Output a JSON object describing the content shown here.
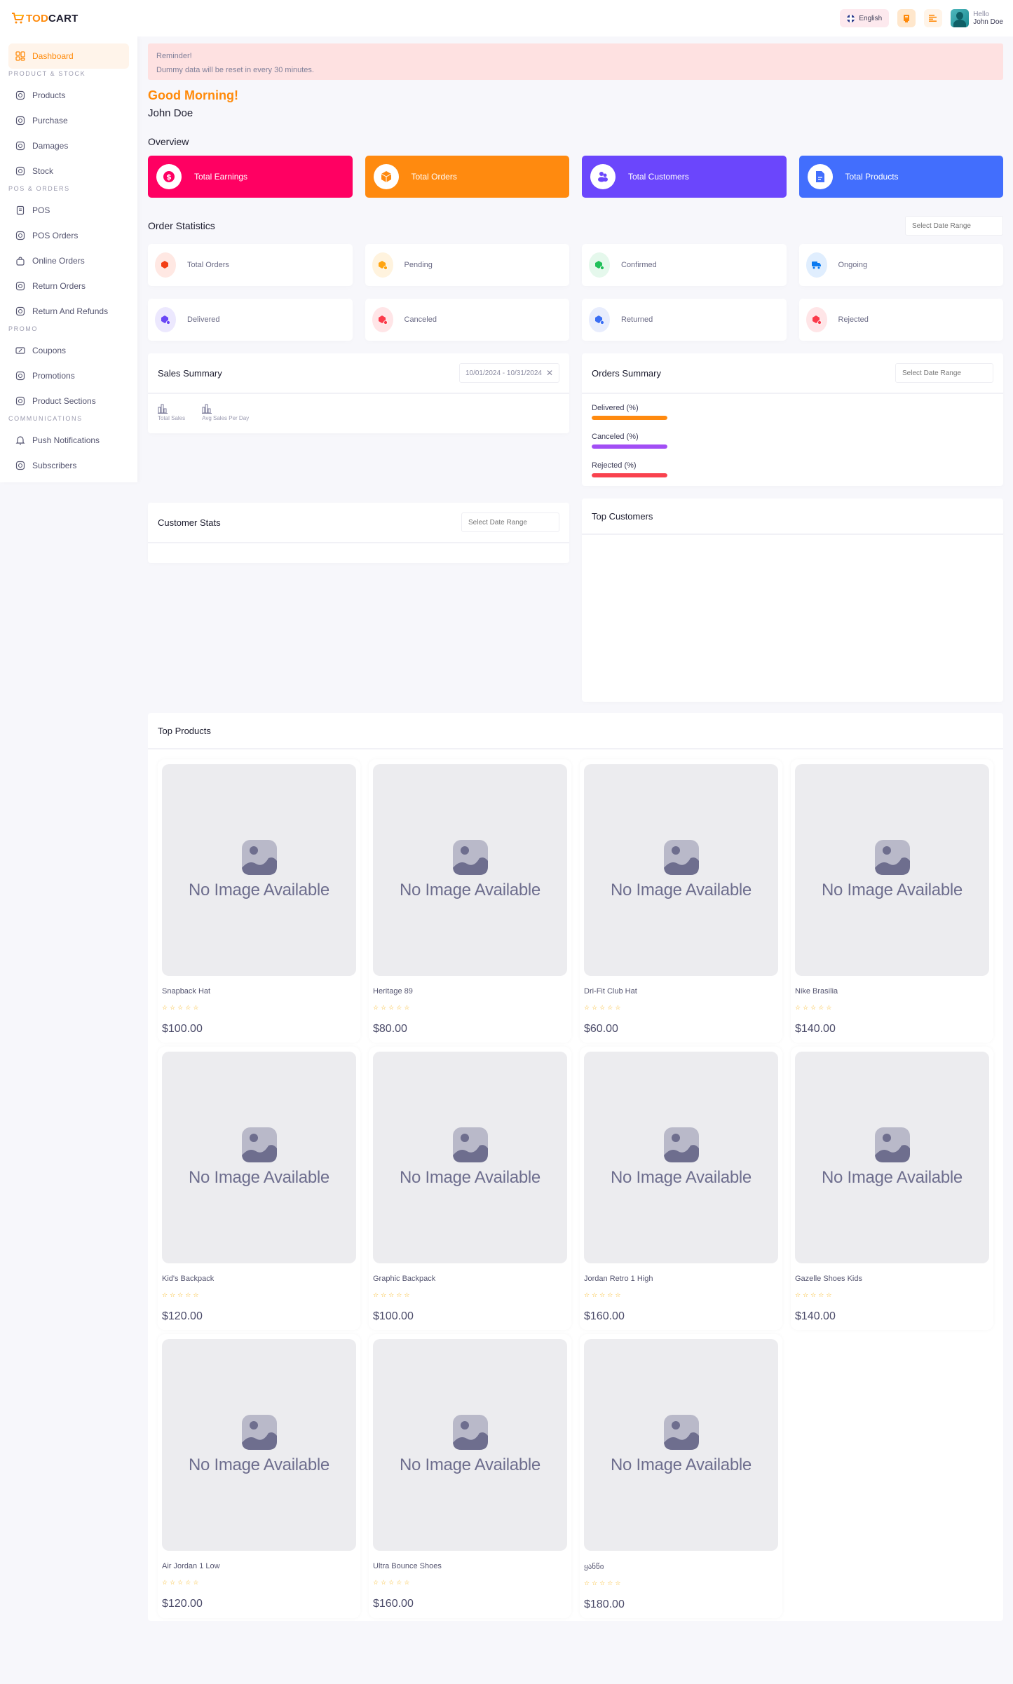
{
  "brand": {
    "part1": "TOD",
    "part2": "CART"
  },
  "header": {
    "language": "English",
    "user_greeting": "Hello",
    "user_name": "John Doe"
  },
  "sidebar": {
    "items": [
      {
        "type": "item",
        "label": "Dashboard",
        "icon": "dashboard-icon",
        "active": true
      },
      {
        "type": "section",
        "label": "PRODUCT & STOCK"
      },
      {
        "type": "item",
        "label": "Products",
        "icon": "products-icon"
      },
      {
        "type": "item",
        "label": "Purchase",
        "icon": "purchase-icon"
      },
      {
        "type": "item",
        "label": "Damages",
        "icon": "damages-icon"
      },
      {
        "type": "item",
        "label": "Stock",
        "icon": "stock-icon"
      },
      {
        "type": "section",
        "label": "POS & ORDERS"
      },
      {
        "type": "item",
        "label": "POS",
        "icon": "pos-icon"
      },
      {
        "type": "item",
        "label": "POS Orders",
        "icon": "pos-orders-icon"
      },
      {
        "type": "item",
        "label": "Online Orders",
        "icon": "online-orders-icon"
      },
      {
        "type": "item",
        "label": "Return Orders",
        "icon": "return-orders-icon"
      },
      {
        "type": "item",
        "label": "Return And Refunds",
        "icon": "refund-icon"
      },
      {
        "type": "section",
        "label": "PROMO"
      },
      {
        "type": "item",
        "label": "Coupons",
        "icon": "coupon-icon"
      },
      {
        "type": "item",
        "label": "Promotions",
        "icon": "promotion-icon"
      },
      {
        "type": "item",
        "label": "Product Sections",
        "icon": "product-sections-icon"
      },
      {
        "type": "section",
        "label": "COMMUNICATIONS"
      },
      {
        "type": "item",
        "label": "Push Notifications",
        "icon": "bell-icon"
      },
      {
        "type": "item",
        "label": "Subscribers",
        "icon": "subscribers-icon"
      }
    ]
  },
  "reminder": {
    "title": "Reminder!",
    "message": "Dummy data will be reset in every 30 minutes."
  },
  "greeting": "Good Morning!",
  "user_name": "John Doe",
  "overview": {
    "title": "Overview",
    "cards": [
      {
        "label": "Total Earnings",
        "color": "#ff0062",
        "icon": "dollar-icon"
      },
      {
        "label": "Total Orders",
        "color": "#ff8a0f",
        "icon": "box-icon"
      },
      {
        "label": "Total Customers",
        "color": "#6b46fc",
        "icon": "users-icon"
      },
      {
        "label": "Total Products",
        "color": "#426efd",
        "icon": "document-icon"
      }
    ]
  },
  "order_statistics": {
    "title": "Order Statistics",
    "date_placeholder": "Select Date Range",
    "cards": [
      {
        "label": "Total Orders",
        "color": "#f23e14",
        "bg": "#ffe8e3",
        "icon": "box-icon"
      },
      {
        "label": "Pending",
        "color": "#ffa411",
        "bg": "#fff3de",
        "icon": "box-pending-icon"
      },
      {
        "label": "Confirmed",
        "color": "#21c05a",
        "bg": "#e5f8ec",
        "icon": "box-confirmed-icon"
      },
      {
        "label": "Ongoing",
        "color": "#0b7af0",
        "bg": "#e0eefe",
        "icon": "truck-icon"
      },
      {
        "label": "Delivered",
        "color": "#6a47f6",
        "bg": "#ece8fe",
        "icon": "box-delivered-icon"
      },
      {
        "label": "Canceled",
        "color": "#fb3b4b",
        "bg": "#ffe5e7",
        "icon": "box-canceled-icon"
      },
      {
        "label": "Returned",
        "color": "#3a6ef4",
        "bg": "#e8edfd",
        "icon": "box-returned-icon"
      },
      {
        "label": "Rejected",
        "color": "#fb3b4b",
        "bg": "#ffe5e7",
        "icon": "box-rejected-icon"
      }
    ]
  },
  "sales_summary": {
    "title": "Sales Summary",
    "date_range": "10/01/2024 - 10/31/2024",
    "metrics": [
      "Total Sales",
      "Avg Sales Per Day"
    ]
  },
  "orders_summary": {
    "title": "Orders Summary",
    "date_placeholder": "Select Date Range",
    "bars": [
      {
        "label": "Delivered (%)",
        "color": "#ff8a0f",
        "percent": 100
      },
      {
        "label": "Canceled (%)",
        "color": "#a24ef5",
        "percent": 100
      },
      {
        "label": "Rejected (%)",
        "color": "#f9424e",
        "percent": 100
      }
    ]
  },
  "customer_stats": {
    "title": "Customer Stats",
    "date_placeholder": "Select Date Range"
  },
  "top_customers": {
    "title": "Top Customers"
  },
  "top_products": {
    "title": "Top Products",
    "no_image_text": "No Image Available",
    "items": [
      {
        "name": "Snapback Hat",
        "price": "$100.00",
        "rating": 0
      },
      {
        "name": "Heritage 89",
        "price": "$80.00",
        "rating": 0
      },
      {
        "name": "Dri-Fit Club Hat",
        "price": "$60.00",
        "rating": 0
      },
      {
        "name": "Nike Brasilia",
        "price": "$140.00",
        "rating": 0
      },
      {
        "name": "Kid's Backpack",
        "price": "$120.00",
        "rating": 0
      },
      {
        "name": "Graphic Backpack",
        "price": "$100.00",
        "rating": 0
      },
      {
        "name": "Jordan Retro 1 High",
        "price": "$160.00",
        "rating": 0
      },
      {
        "name": "Gazelle Shoes Kids",
        "price": "$140.00",
        "rating": 0
      },
      {
        "name": "Air Jordan 1 Low",
        "price": "$120.00",
        "rating": 0
      },
      {
        "name": "Ultra Bounce Shoes",
        "price": "$160.00",
        "rating": 0
      },
      {
        "name": "ყანწი",
        "price": "$180.00",
        "rating": 0
      }
    ]
  }
}
